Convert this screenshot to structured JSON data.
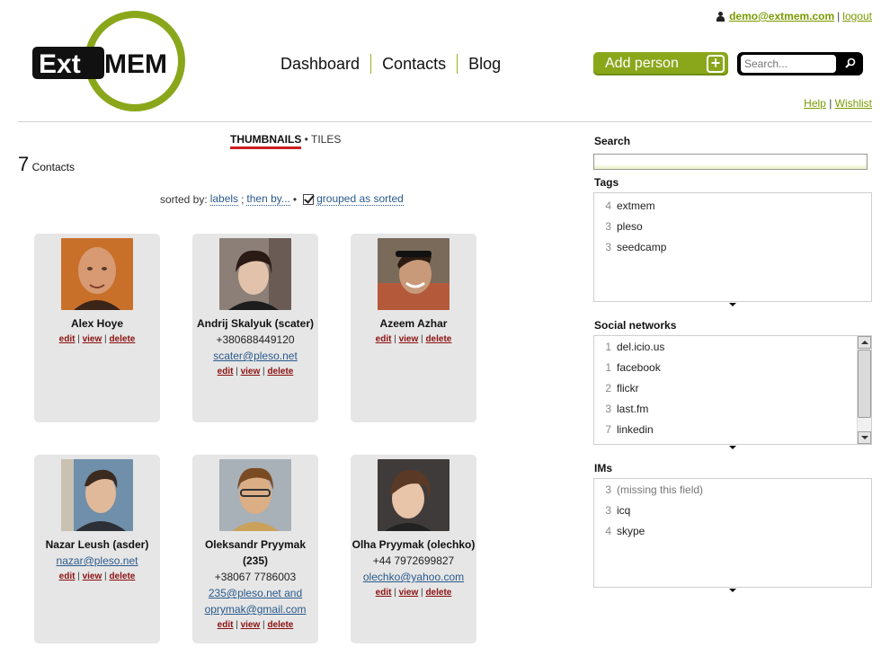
{
  "header": {
    "logo_text": "ExtMEM",
    "nav": [
      "Dashboard",
      "Contacts",
      "Blog"
    ],
    "user_email": "demo@extmem.com",
    "logout": "logout",
    "add_person": "Add person",
    "search_placeholder": "Search...",
    "help": "Help",
    "wishlist": "Wishlist",
    "accent_color": "#8aa71b"
  },
  "view": {
    "thumbnails": "THUMBNAILS",
    "separator": "•",
    "tiles": "TILES",
    "count": "7",
    "count_label": "Contacts",
    "sorted_prefix": "sorted by:",
    "sorted_labels": "labels",
    "sorted_then": "then by...",
    "grouped": "grouped as sorted"
  },
  "actions": {
    "edit": "edit",
    "view": "view",
    "delete": "delete"
  },
  "contacts": [
    {
      "name": "Alex Hoye"
    },
    {
      "name": "Andrij Skalyuk (scater)",
      "phone": "+380688449120",
      "email": "scater@pleso.net"
    },
    {
      "name": "Azeem Azhar"
    },
    {
      "name": "Nazar Leush (asder)",
      "email": "nazar@pleso.net"
    },
    {
      "name": "Oleksandr Pryymak (235)",
      "phone": "+38067 7786003",
      "email": "235@pleso.net and oprymak@gmail.com"
    },
    {
      "name": "Olha Pryymak (olechko)",
      "phone": "+44 7972699827",
      "email": "olechko@yahoo.com"
    }
  ],
  "sidebar": {
    "search_label": "Search",
    "tags_label": "Tags",
    "tags": [
      {
        "n": "4",
        "label": "extmem"
      },
      {
        "n": "3",
        "label": "pleso"
      },
      {
        "n": "3",
        "label": "seedcamp"
      }
    ],
    "social_label": "Social networks",
    "social": [
      {
        "n": "1",
        "label": "del.icio.us"
      },
      {
        "n": "1",
        "label": "facebook"
      },
      {
        "n": "2",
        "label": "flickr"
      },
      {
        "n": "3",
        "label": "last.fm"
      },
      {
        "n": "7",
        "label": "linkedin"
      }
    ],
    "ims_label": "IMs",
    "ims": [
      {
        "n": "3",
        "label": "(missing this field)"
      },
      {
        "n": "3",
        "label": "icq"
      },
      {
        "n": "4",
        "label": "skype"
      }
    ]
  }
}
